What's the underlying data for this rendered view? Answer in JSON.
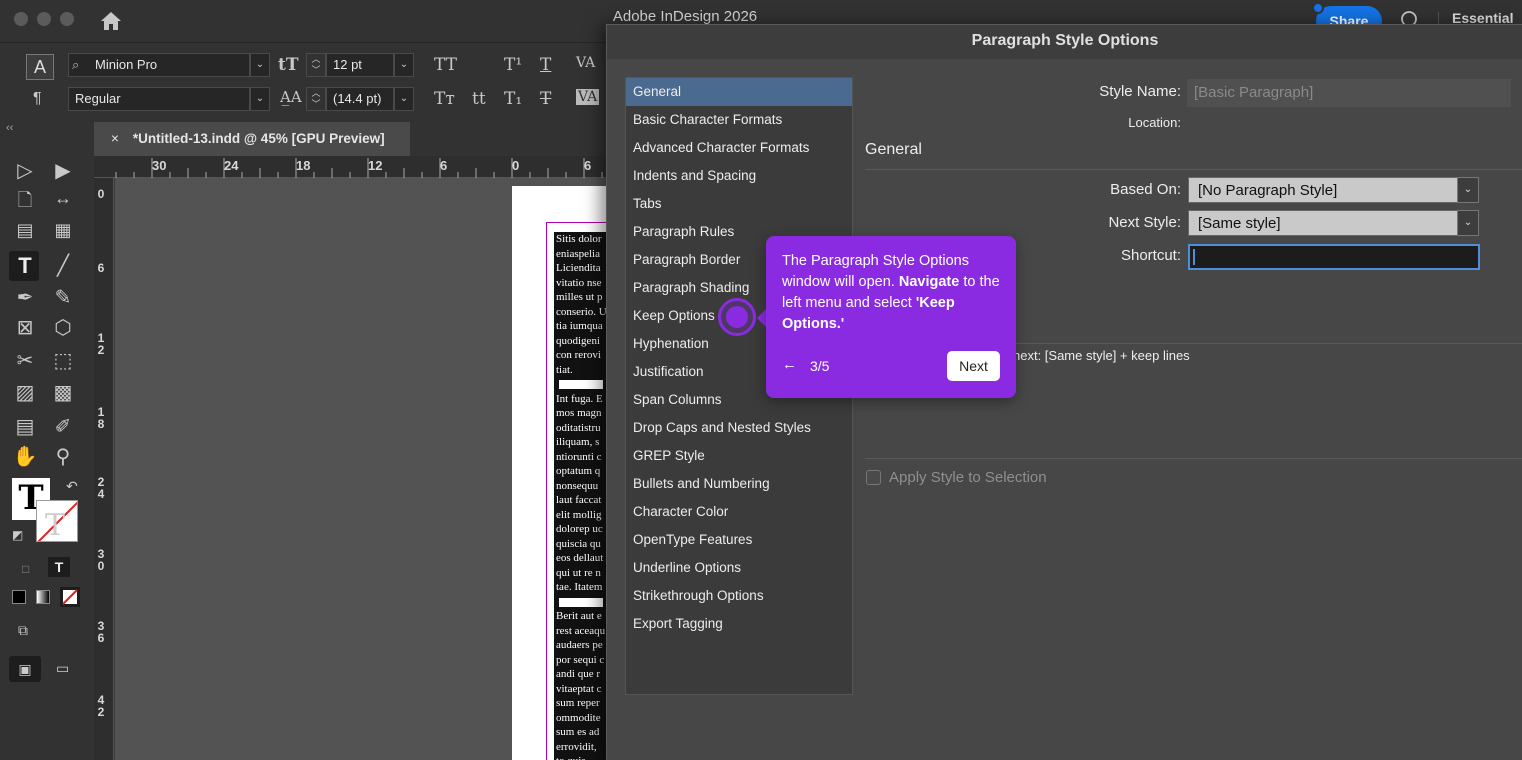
{
  "app": {
    "title": "Adobe InDesign 2026",
    "share_label": "Share",
    "workspace_label": "Essential"
  },
  "control_panel": {
    "font_family": "Minion Pro",
    "font_style": "Regular",
    "font_size": "12 pt",
    "leading": "(14.4 pt)"
  },
  "document": {
    "tab_title": "*Untitled-13.indd @ 45% [GPU Preview]",
    "tab_close": "×",
    "ruler_h": [
      "30",
      "24",
      "18",
      "12",
      "6",
      "0",
      "6"
    ],
    "ruler_v": [
      "0",
      "6",
      "12",
      "18",
      "24",
      "30",
      "36",
      "42"
    ],
    "text_lines": [
      "Sitis dolor",
      "eniaspelia",
      "Liciendita",
      "vitatio nse",
      "milles ut p",
      "conserio. U",
      "tia iumqua",
      "quodigeni",
      "con rerovi",
      "tiat.",
      "",
      "Int fuga. E",
      "mos magn",
      "oditatistru",
      "iliquam, s",
      "ntiorunti c",
      "optatum q",
      "nonsequu",
      "laut faccat",
      "elit mollig",
      "dolorep uc",
      "quiscia qu",
      "eos dellaut",
      "qui ut re n",
      "tae. Itatem",
      "",
      "Berit aut e",
      "rest aceaqu",
      "audaers pe",
      "por sequi c",
      "andi que r",
      "vitaeptat c",
      "sum reper",
      "ommodite",
      "sum es ad",
      "errovidit,",
      "to quis"
    ]
  },
  "dialog": {
    "title": "Paragraph Style Options",
    "categories": [
      "General",
      "Basic Character Formats",
      "Advanced Character Formats",
      "Indents and Spacing",
      "Tabs",
      "Paragraph Rules",
      "Paragraph Border",
      "Paragraph Shading",
      "Keep Options",
      "Hyphenation",
      "Justification",
      "Span Columns",
      "Drop Caps and Nested Styles",
      "GREP Style",
      "Bullets and Numbering",
      "Character Color",
      "OpenType Features",
      "Underline Options",
      "Strikethrough Options",
      "Export Tagging"
    ],
    "style_name_label": "Style Name:",
    "style_name_value": "[Basic Paragraph]",
    "location_label": "Location:",
    "section_title": "General",
    "based_on_label": "Based On:",
    "based_on_value": "[No Paragraph Style]",
    "next_style_label": "Next Style:",
    "next_style_value": "[Same style]",
    "shortcut_label": "Shortcut:",
    "shortcut_value": "",
    "style_settings_tail": "next: [Same style] + keep lines",
    "apply_label": "Apply Style to Selection"
  },
  "tour": {
    "text_intro": "The Paragraph Style Options window will open. ",
    "text_navigate": "Navigate",
    "text_mid": " to the left menu and select ",
    "text_target": "'Keep Options.'",
    "back_icon": "←",
    "step": "3/5",
    "next_label": "Next",
    "accent_color": "#8a2be2"
  },
  "colors": {
    "selection": "#4a6a8f",
    "frame": "#b400b4"
  }
}
